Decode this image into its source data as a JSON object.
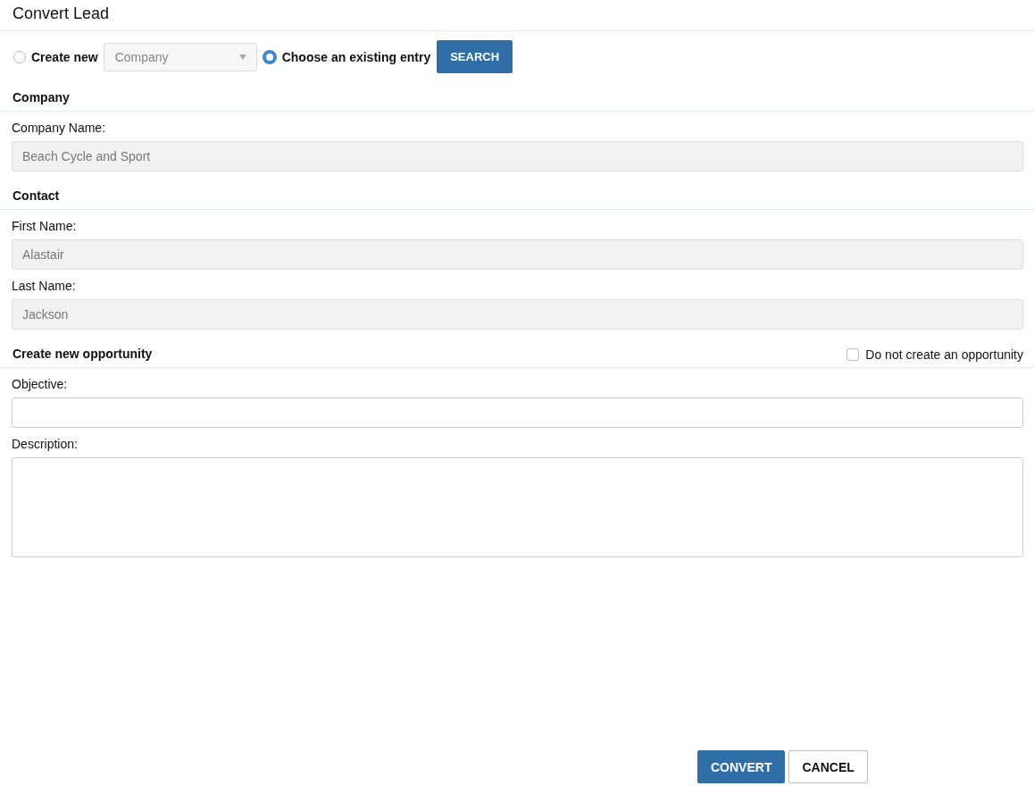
{
  "title": "Convert Lead",
  "source_options": [
    {
      "label": "Create new",
      "selected": false,
      "dropdown": {
        "value": "Company",
        "disabled": true
      }
    },
    {
      "label": "Choose an existing entry",
      "selected": true,
      "button": "SEARCH"
    }
  ],
  "sections": [
    {
      "heading": "Company",
      "fields": [
        {
          "kind": "text",
          "label": "Company Name:",
          "value": "Beach Cycle and Sport",
          "disabled": true
        }
      ]
    },
    {
      "heading": "Contact",
      "fields": [
        {
          "kind": "text",
          "label": "First Name:",
          "value": "Alastair",
          "disabled": true
        },
        {
          "kind": "text",
          "label": "Last Name:",
          "value": "Jackson",
          "disabled": true
        }
      ]
    },
    {
      "heading": "Create new opportunity",
      "option": {
        "label": "Do not create an opportunity",
        "checked": false
      },
      "fields": [
        {
          "kind": "text",
          "label": "Objective:",
          "disabled": false
        },
        {
          "kind": "textarea",
          "label": "Description:",
          "disabled": false
        }
      ]
    }
  ],
  "buttons": [
    {
      "kind": "primary",
      "label": "CONVERT"
    },
    {
      "kind": "secondary",
      "label": "CANCEL"
    }
  ]
}
